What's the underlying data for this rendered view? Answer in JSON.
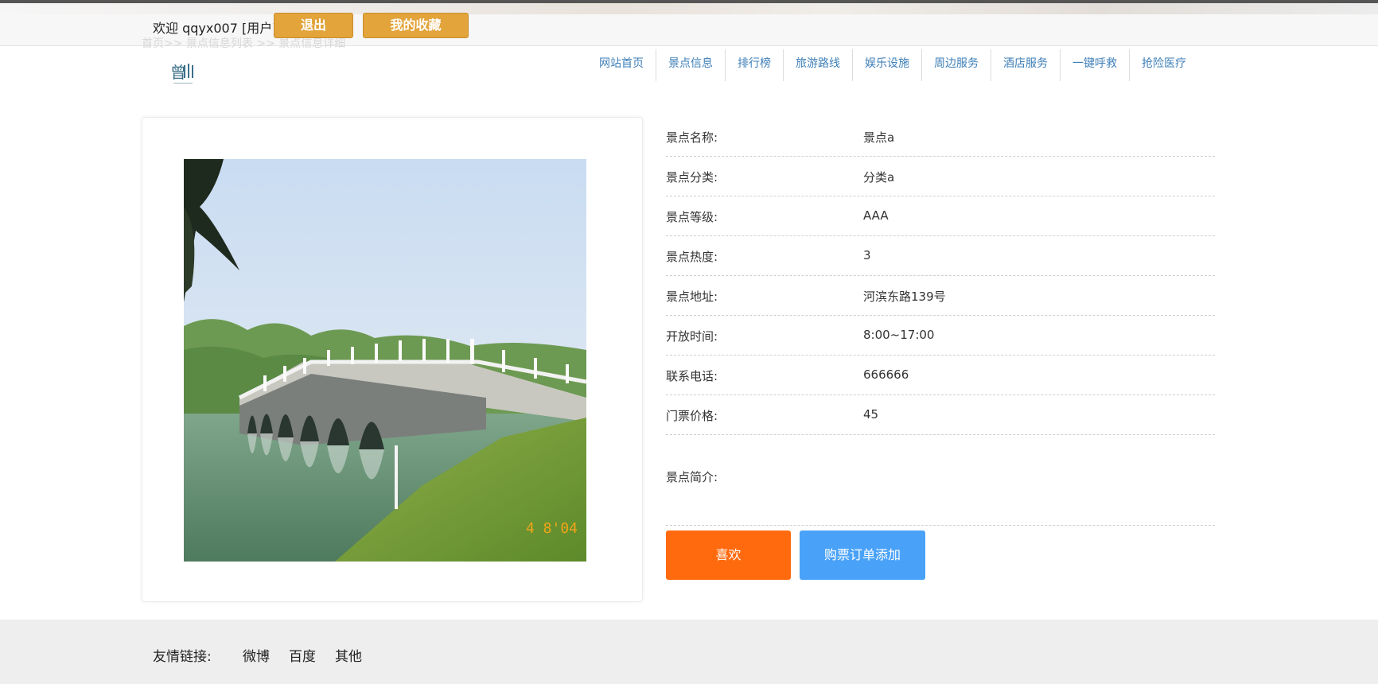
{
  "header": {
    "welcome": "欢迎 qqyx007 [用户]",
    "logout_label": "退出",
    "favorites_label": "我的收藏",
    "breadcrumb": "首页>>  景点信息列表  >>  景点信息详细"
  },
  "nav": {
    "items": [
      "网站首页",
      "景点信息",
      "排行榜",
      "旅游路线",
      "娱乐设施",
      "周边服务",
      "酒店服务",
      "一键呼救",
      "抢险医疗"
    ]
  },
  "photo": {
    "stamp": "4 8'04"
  },
  "details": {
    "rows": [
      {
        "label": "景点名称:",
        "value": "景点a"
      },
      {
        "label": "景点分类:",
        "value": "分类a"
      },
      {
        "label": "景点等级:",
        "value": "AAA"
      },
      {
        "label": "景点热度:",
        "value": "3"
      },
      {
        "label": "景点地址:",
        "value": "河滨东路139号"
      },
      {
        "label": "开放时间:",
        "value": "8:00~17:00"
      },
      {
        "label": "联系电话:",
        "value": "666666"
      },
      {
        "label": "门票价格:",
        "value": "45"
      }
    ],
    "intro_label": "景点简介:"
  },
  "actions": {
    "like_label": "喜欢",
    "order_label": "购票订单添加",
    "like_color": "#ff6a0e",
    "order_color": "#4aa2f8"
  },
  "footer": {
    "label": "友情链接:",
    "links": [
      "微博",
      "百度",
      "其他"
    ]
  }
}
